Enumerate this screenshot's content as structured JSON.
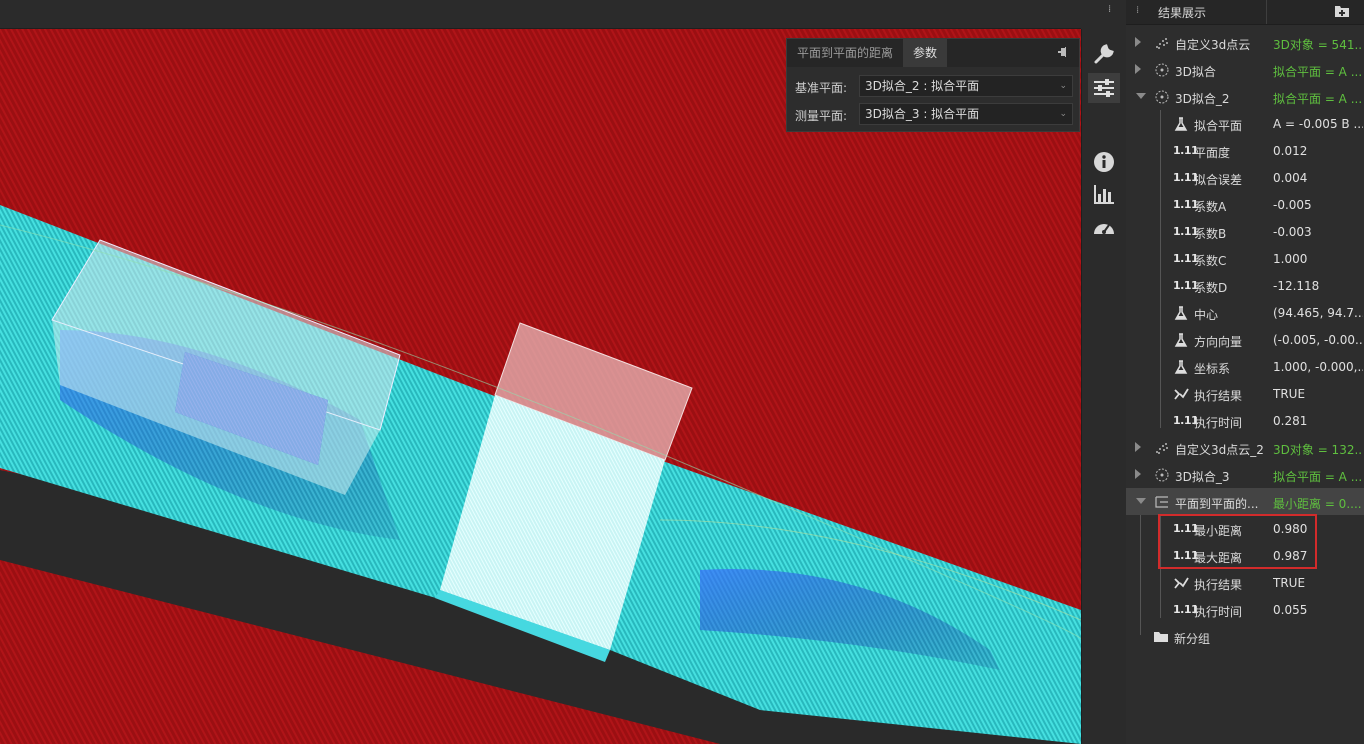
{
  "viewport": {
    "colors": {
      "plane_red": "#a21013",
      "surface_cyan": "#3ad8d8",
      "dark_bg": "#2a2a2a",
      "highlight": "#d22b2b"
    }
  },
  "param_panel": {
    "tabs": [
      "平面到平面的距离",
      "参数"
    ],
    "active_tab": "参数",
    "rows": [
      {
        "label": "基准平面:",
        "value": "3D拟合_2 : 拟合平面"
      },
      {
        "label": "测量平面:",
        "value": "3D拟合_3 : 拟合平面"
      }
    ]
  },
  "tools": [
    "wrench-icon",
    "sliders-icon",
    "info-icon",
    "chart-icon",
    "gauge-icon"
  ],
  "results": {
    "title": "结果展示",
    "tree": [
      {
        "name": "自定义3d点云",
        "value": "3D对象 = 541...",
        "icon": "pointcloud-icon",
        "value_color": "green"
      },
      {
        "name": "3D拟合",
        "value": "拟合平面 = A ...",
        "icon": "fit-icon",
        "value_color": "green"
      },
      {
        "name": "3D拟合_2",
        "value": "拟合平面 = A ...",
        "icon": "fit-icon",
        "value_color": "green"
      },
      {
        "name": "拟合平面",
        "value": "A = -0.005 B ...",
        "icon": "flask-icon"
      },
      {
        "name": "平面度",
        "value": "0.012",
        "icon": "number-icon"
      },
      {
        "name": "拟合误差",
        "value": "0.004",
        "icon": "number-icon"
      },
      {
        "name": "系数A",
        "value": "-0.005",
        "icon": "number-icon"
      },
      {
        "name": "系数B",
        "value": "-0.003",
        "icon": "number-icon"
      },
      {
        "name": "系数C",
        "value": "1.000",
        "icon": "number-icon"
      },
      {
        "name": "系数D",
        "value": "-12.118",
        "icon": "number-icon"
      },
      {
        "name": "中心",
        "value": "(94.465, 94.7...",
        "icon": "flask-icon"
      },
      {
        "name": "方向向量",
        "value": "(-0.005, -0.00...",
        "icon": "flask-icon"
      },
      {
        "name": "坐标系",
        "value": "1.000, -0.000,...",
        "icon": "flask-icon"
      },
      {
        "name": "执行结果",
        "value": "TRUE",
        "icon": "check-icon"
      },
      {
        "name": "执行时间",
        "value": "0.281",
        "icon": "number-icon"
      },
      {
        "name": "自定义3d点云_2",
        "value": "3D对象 = 132...",
        "icon": "pointcloud-icon",
        "value_color": "green"
      },
      {
        "name": "3D拟合_3",
        "value": "拟合平面 = A ...",
        "icon": "fit-icon",
        "value_color": "green"
      },
      {
        "name": "平面到平面的...",
        "value": "最小距离 = 0....",
        "icon": "measure-icon",
        "value_color": "green"
      },
      {
        "name": "最小距离",
        "value": "0.980",
        "icon": "number-icon"
      },
      {
        "name": "最大距离",
        "value": "0.987",
        "icon": "number-icon"
      },
      {
        "name": "执行结果",
        "value": "TRUE",
        "icon": "check-icon"
      },
      {
        "name": "执行时间",
        "value": "0.055",
        "icon": "number-icon"
      },
      {
        "name": "新分组",
        "value": "",
        "icon": "folder-icon"
      }
    ],
    "number_icon_glyph": "1.11"
  }
}
